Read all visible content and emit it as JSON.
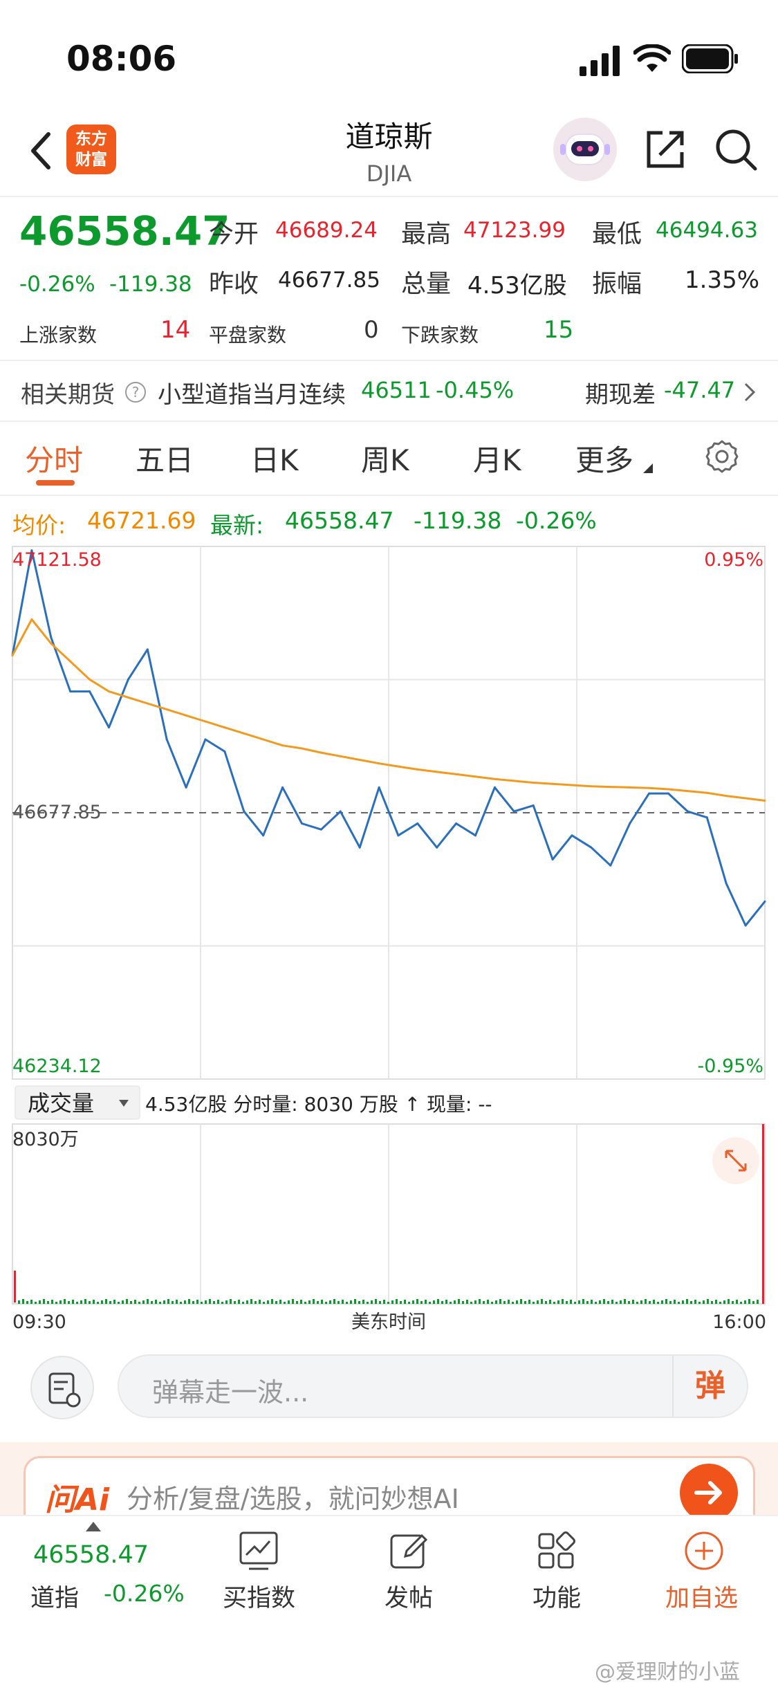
{
  "status_bar": {
    "time": "08:06"
  },
  "header": {
    "title": "道琼斯",
    "subtitle": "DJIA",
    "logo_line1": "东方",
    "logo_line2": "财富"
  },
  "quote": {
    "price": "46558.47",
    "change_pct": "-0.26%",
    "change": "-119.38",
    "open_label": "今开",
    "open": "46689.24",
    "high_label": "最高",
    "high": "47123.99",
    "low_label": "最低",
    "low": "46494.63",
    "prev_close_label": "昨收",
    "prev_close": "46677.85",
    "volume_label": "总量",
    "volume": "4.53亿股",
    "amplitude_label": "振幅",
    "amplitude": "1.35%",
    "up_label": "上涨家数",
    "up_count": "14",
    "flat_label": "平盘家数",
    "flat_count": "0",
    "down_label": "下跌家数",
    "down_count": "15"
  },
  "futures": {
    "label": "相关期货",
    "name": "小型道指当月连续",
    "price": "46511",
    "pct": "-0.45%",
    "basis_label": "期现差",
    "basis": "-47.47"
  },
  "tabs": [
    "分时",
    "五日",
    "日K",
    "周K",
    "月K",
    "更多"
  ],
  "active_tab": "分时",
  "chart_info": {
    "avg_label": "均价:",
    "avg": "46721.69",
    "latest_label": "最新:",
    "latest": "46558.47",
    "latest_change": "-119.38",
    "latest_pct": "-0.26%"
  },
  "chart_data": {
    "type": "line",
    "y_max_label": "47121.58",
    "y_min_label": "46234.12",
    "y_mid_label": "46677.85",
    "pct_max_label": "0.95%",
    "pct_min_label": "-0.95%",
    "ylim": [
      46234.12,
      47121.58
    ],
    "prev_close": 46677.85,
    "x_start_label": "09:30",
    "x_end_label": "16:00",
    "x_axis_label": "美东时间",
    "x": [
      "09:30",
      "09:40",
      "09:50",
      "10:00",
      "10:10",
      "10:20",
      "10:30",
      "10:40",
      "10:50",
      "11:00",
      "11:10",
      "11:20",
      "11:30",
      "11:40",
      "11:50",
      "12:00",
      "12:10",
      "12:20",
      "12:30",
      "12:40",
      "12:50",
      "13:00",
      "13:10",
      "13:20",
      "13:30",
      "13:40",
      "13:50",
      "14:00",
      "14:10",
      "14:20",
      "14:30",
      "14:40",
      "14:50",
      "15:00",
      "15:10",
      "15:20",
      "15:30",
      "15:40",
      "15:50",
      "16:00"
    ],
    "series": [
      {
        "values": [
          46940,
          47115,
          46970,
          46880,
          46880,
          46820,
          46900,
          46950,
          46800,
          46720,
          46800,
          46780,
          46680,
          46640,
          46720,
          46660,
          46650,
          46680,
          46620,
          46720,
          46640,
          46660,
          46620,
          46660,
          46640,
          46720,
          46680,
          46690,
          46600,
          46640,
          46620,
          46590,
          46660,
          46710,
          46710,
          46680,
          46670,
          46560,
          46490,
          46530
        ]
      },
      {
        "values": [
          46940,
          47000,
          46960,
          46930,
          46900,
          46880,
          46870,
          46860,
          46850,
          46840,
          46830,
          46820,
          46810,
          46800,
          46790,
          46785,
          46778,
          46772,
          46766,
          46760,
          46755,
          46750,
          46746,
          46742,
          46738,
          46734,
          46731,
          46728,
          46726,
          46724,
          46722,
          46721,
          46720,
          46719,
          46717,
          46714,
          46711,
          46706,
          46702,
          46698
        ]
      }
    ],
    "volume_label": "成交量",
    "volume_summary": "4.53亿股 分时量: 8030 万股 ↑ 现量: --",
    "volume_max_label": "8030万"
  },
  "composer": {
    "placeholder": "弹幕走一波...",
    "send_label": "弹"
  },
  "ai_bar": {
    "logo": "问Ai",
    "text": "分析/复盘/选股，就问妙想AI"
  },
  "bottom_nav": {
    "index_price": "46558.47",
    "index_name": "道指",
    "index_pct": "-0.26%",
    "items": [
      "买指数",
      "发帖",
      "功能",
      "加自选"
    ]
  },
  "watermark": "@爱理财的小蓝",
  "colors": {
    "up": "#e8232b",
    "down": "#0d9a2c",
    "accent": "#e8602a",
    "avg_line": "#f29a1e",
    "price_line": "#2a6fbd"
  }
}
